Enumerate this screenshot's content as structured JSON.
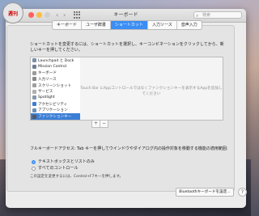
{
  "logo_text": "週刊",
  "window": {
    "title": "キーボード",
    "back": "‹",
    "forward": "›",
    "search_placeholder": "検索"
  },
  "tabs": [
    {
      "label": "キーボード",
      "active": false
    },
    {
      "label": "ユーザ辞書",
      "active": false
    },
    {
      "label": "ショートカット",
      "active": true
    },
    {
      "label": "入力ソース",
      "active": false
    },
    {
      "label": "音声入力",
      "active": false
    }
  ],
  "description": "ショートカットを変更するには、ショートカットを選択し、キーコンビネーションをクリックしてから、新しいキーを押してください。",
  "categories": [
    {
      "label": "Launchpad と Dock",
      "icon": "launchpad-icon",
      "color": "#7a8fa8",
      "selected": false
    },
    {
      "label": "Mission Control",
      "icon": "mission-control-icon",
      "color": "#6f7f95",
      "selected": false
    },
    {
      "label": "キーボード",
      "icon": "keyboard-icon",
      "color": "#9a9a9a",
      "selected": false
    },
    {
      "label": "入力ソース",
      "icon": "input-sources-icon",
      "color": "#8a8a8a",
      "selected": false
    },
    {
      "label": "スクリーンショット",
      "icon": "screenshot-icon",
      "color": "#a0a0a0",
      "selected": false
    },
    {
      "label": "サービス",
      "icon": "services-icon",
      "color": "#b0b0b0",
      "selected": false
    },
    {
      "label": "Spotlight",
      "icon": "spotlight-icon",
      "color": "#8899aa",
      "selected": false
    },
    {
      "label": "アクセシビリティ",
      "icon": "accessibility-icon",
      "color": "#3d7bd6",
      "selected": false
    },
    {
      "label": "アプリケーション",
      "icon": "applications-icon",
      "color": "#6e8fb8",
      "selected": false
    },
    {
      "label": "ファンクションキー",
      "icon": "function-keys-icon",
      "color": "#5a5a5a",
      "selected": true
    }
  ],
  "detail_text": "Touch Bar にAppコントロールではなくファンクションキーを表示するAppを追加してください",
  "add_label": "+",
  "remove_label": "−",
  "full_keyboard_access_label": "フルキーボードアクセス: Tab キーを押してウインドウやダイアログ内の操作対象を移動する機能の適用範囲:",
  "radio_options": [
    {
      "label": "テキストボックスとリストのみ",
      "checked": true
    },
    {
      "label": "すべてのコントロール",
      "checked": false
    }
  ],
  "note": "この設定を変更するには、Control+F7キーを押します。",
  "bluetooth_button": "Bluetoothキーボードを設定...",
  "help_label": "?"
}
